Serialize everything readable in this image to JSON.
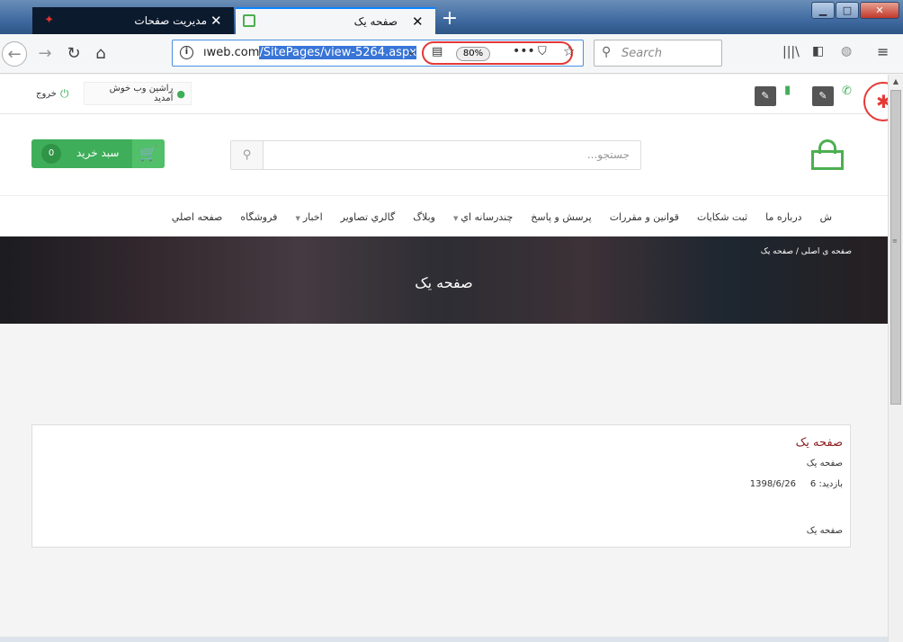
{
  "browser": {
    "tabs": [
      {
        "title": "مديريت صفحات",
        "active": false,
        "favicon": "site-logo-icon"
      },
      {
        "title": "صفحه يک",
        "active": true,
        "favicon": "page-icon"
      }
    ],
    "url_prefix": "ıweb.com",
    "url_highlight": "/SitePages/view-5264.aspx",
    "zoom": "80%",
    "search_placeholder": "Search",
    "highlight_color": "#e53935"
  },
  "site": {
    "logout": "خروج",
    "welcome": "راشين وب خوش آمديد",
    "cart_label": "سبد خريد",
    "cart_count": "0",
    "search_placeholder": "جستجو...",
    "accent_color": "#3fae5a",
    "menu": [
      {
        "label": "صفحه اصلي",
        "caret": ""
      },
      {
        "label": "فروشگاه",
        "caret": ""
      },
      {
        "label": "اخبار",
        "caret": "▼"
      },
      {
        "label": "گالري تصاوير",
        "caret": ""
      },
      {
        "label": "وبلاگ",
        "caret": ""
      },
      {
        "label": "چندرسانه اي",
        "caret": "▼"
      },
      {
        "label": "پرسش و پاسخ",
        "caret": ""
      },
      {
        "label": "قوانين و مقررات",
        "caret": ""
      },
      {
        "label": "ثبت شكايات",
        "caret": ""
      },
      {
        "label": "درباره ما",
        "caret": ""
      },
      {
        "label": "ش",
        "caret": ""
      }
    ],
    "breadcrumb": "صفحه ی اصلی / صفحه یک",
    "banner_title": "صفحه يک",
    "content": {
      "title": "صفحه يک",
      "subtitle": "صفحه يک",
      "date": "1398/6/26",
      "visits_label": "بازديد:",
      "visits": "6",
      "body": "صفحه يک"
    }
  }
}
